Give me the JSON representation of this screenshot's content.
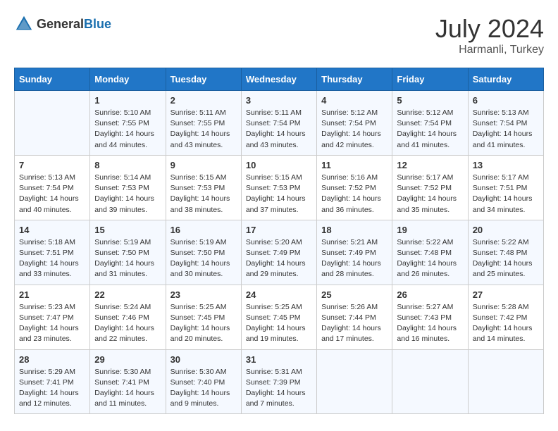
{
  "header": {
    "logo_general": "General",
    "logo_blue": "Blue",
    "month_year": "July 2024",
    "location": "Harmanli, Turkey"
  },
  "days_of_week": [
    "Sunday",
    "Monday",
    "Tuesday",
    "Wednesday",
    "Thursday",
    "Friday",
    "Saturday"
  ],
  "weeks": [
    [
      {
        "day": "",
        "sunrise": "",
        "sunset": "",
        "daylight": ""
      },
      {
        "day": "1",
        "sunrise": "Sunrise: 5:10 AM",
        "sunset": "Sunset: 7:55 PM",
        "daylight": "Daylight: 14 hours and 44 minutes."
      },
      {
        "day": "2",
        "sunrise": "Sunrise: 5:11 AM",
        "sunset": "Sunset: 7:55 PM",
        "daylight": "Daylight: 14 hours and 43 minutes."
      },
      {
        "day": "3",
        "sunrise": "Sunrise: 5:11 AM",
        "sunset": "Sunset: 7:54 PM",
        "daylight": "Daylight: 14 hours and 43 minutes."
      },
      {
        "day": "4",
        "sunrise": "Sunrise: 5:12 AM",
        "sunset": "Sunset: 7:54 PM",
        "daylight": "Daylight: 14 hours and 42 minutes."
      },
      {
        "day": "5",
        "sunrise": "Sunrise: 5:12 AM",
        "sunset": "Sunset: 7:54 PM",
        "daylight": "Daylight: 14 hours and 41 minutes."
      },
      {
        "day": "6",
        "sunrise": "Sunrise: 5:13 AM",
        "sunset": "Sunset: 7:54 PM",
        "daylight": "Daylight: 14 hours and 41 minutes."
      }
    ],
    [
      {
        "day": "7",
        "sunrise": "Sunrise: 5:13 AM",
        "sunset": "Sunset: 7:54 PM",
        "daylight": "Daylight: 14 hours and 40 minutes."
      },
      {
        "day": "8",
        "sunrise": "Sunrise: 5:14 AM",
        "sunset": "Sunset: 7:53 PM",
        "daylight": "Daylight: 14 hours and 39 minutes."
      },
      {
        "day": "9",
        "sunrise": "Sunrise: 5:15 AM",
        "sunset": "Sunset: 7:53 PM",
        "daylight": "Daylight: 14 hours and 38 minutes."
      },
      {
        "day": "10",
        "sunrise": "Sunrise: 5:15 AM",
        "sunset": "Sunset: 7:53 PM",
        "daylight": "Daylight: 14 hours and 37 minutes."
      },
      {
        "day": "11",
        "sunrise": "Sunrise: 5:16 AM",
        "sunset": "Sunset: 7:52 PM",
        "daylight": "Daylight: 14 hours and 36 minutes."
      },
      {
        "day": "12",
        "sunrise": "Sunrise: 5:17 AM",
        "sunset": "Sunset: 7:52 PM",
        "daylight": "Daylight: 14 hours and 35 minutes."
      },
      {
        "day": "13",
        "sunrise": "Sunrise: 5:17 AM",
        "sunset": "Sunset: 7:51 PM",
        "daylight": "Daylight: 14 hours and 34 minutes."
      }
    ],
    [
      {
        "day": "14",
        "sunrise": "Sunrise: 5:18 AM",
        "sunset": "Sunset: 7:51 PM",
        "daylight": "Daylight: 14 hours and 33 minutes."
      },
      {
        "day": "15",
        "sunrise": "Sunrise: 5:19 AM",
        "sunset": "Sunset: 7:50 PM",
        "daylight": "Daylight: 14 hours and 31 minutes."
      },
      {
        "day": "16",
        "sunrise": "Sunrise: 5:19 AM",
        "sunset": "Sunset: 7:50 PM",
        "daylight": "Daylight: 14 hours and 30 minutes."
      },
      {
        "day": "17",
        "sunrise": "Sunrise: 5:20 AM",
        "sunset": "Sunset: 7:49 PM",
        "daylight": "Daylight: 14 hours and 29 minutes."
      },
      {
        "day": "18",
        "sunrise": "Sunrise: 5:21 AM",
        "sunset": "Sunset: 7:49 PM",
        "daylight": "Daylight: 14 hours and 28 minutes."
      },
      {
        "day": "19",
        "sunrise": "Sunrise: 5:22 AM",
        "sunset": "Sunset: 7:48 PM",
        "daylight": "Daylight: 14 hours and 26 minutes."
      },
      {
        "day": "20",
        "sunrise": "Sunrise: 5:22 AM",
        "sunset": "Sunset: 7:48 PM",
        "daylight": "Daylight: 14 hours and 25 minutes."
      }
    ],
    [
      {
        "day": "21",
        "sunrise": "Sunrise: 5:23 AM",
        "sunset": "Sunset: 7:47 PM",
        "daylight": "Daylight: 14 hours and 23 minutes."
      },
      {
        "day": "22",
        "sunrise": "Sunrise: 5:24 AM",
        "sunset": "Sunset: 7:46 PM",
        "daylight": "Daylight: 14 hours and 22 minutes."
      },
      {
        "day": "23",
        "sunrise": "Sunrise: 5:25 AM",
        "sunset": "Sunset: 7:45 PM",
        "daylight": "Daylight: 14 hours and 20 minutes."
      },
      {
        "day": "24",
        "sunrise": "Sunrise: 5:25 AM",
        "sunset": "Sunset: 7:45 PM",
        "daylight": "Daylight: 14 hours and 19 minutes."
      },
      {
        "day": "25",
        "sunrise": "Sunrise: 5:26 AM",
        "sunset": "Sunset: 7:44 PM",
        "daylight": "Daylight: 14 hours and 17 minutes."
      },
      {
        "day": "26",
        "sunrise": "Sunrise: 5:27 AM",
        "sunset": "Sunset: 7:43 PM",
        "daylight": "Daylight: 14 hours and 16 minutes."
      },
      {
        "day": "27",
        "sunrise": "Sunrise: 5:28 AM",
        "sunset": "Sunset: 7:42 PM",
        "daylight": "Daylight: 14 hours and 14 minutes."
      }
    ],
    [
      {
        "day": "28",
        "sunrise": "Sunrise: 5:29 AM",
        "sunset": "Sunset: 7:41 PM",
        "daylight": "Daylight: 14 hours and 12 minutes."
      },
      {
        "day": "29",
        "sunrise": "Sunrise: 5:30 AM",
        "sunset": "Sunset: 7:41 PM",
        "daylight": "Daylight: 14 hours and 11 minutes."
      },
      {
        "day": "30",
        "sunrise": "Sunrise: 5:30 AM",
        "sunset": "Sunset: 7:40 PM",
        "daylight": "Daylight: 14 hours and 9 minutes."
      },
      {
        "day": "31",
        "sunrise": "Sunrise: 5:31 AM",
        "sunset": "Sunset: 7:39 PM",
        "daylight": "Daylight: 14 hours and 7 minutes."
      },
      {
        "day": "",
        "sunrise": "",
        "sunset": "",
        "daylight": ""
      },
      {
        "day": "",
        "sunrise": "",
        "sunset": "",
        "daylight": ""
      },
      {
        "day": "",
        "sunrise": "",
        "sunset": "",
        "daylight": ""
      }
    ]
  ]
}
